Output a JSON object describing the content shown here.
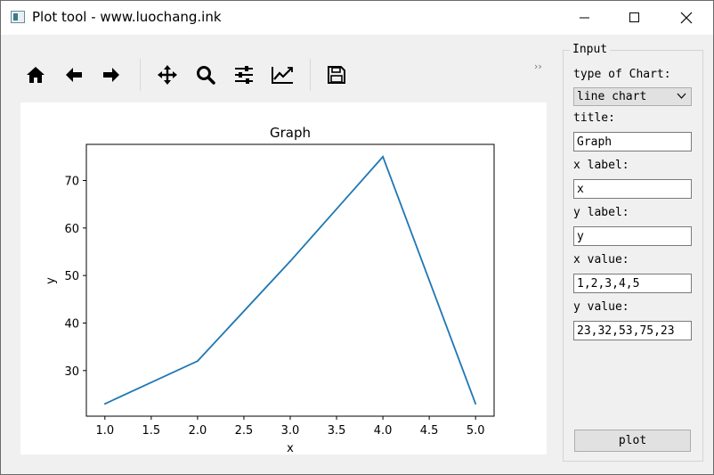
{
  "window": {
    "title": "Plot tool - www.luochang.ink",
    "controls": [
      "minimize-icon",
      "maximize-icon",
      "close-icon"
    ]
  },
  "toolbar": {
    "buttons": [
      {
        "icon": "home-icon"
      },
      {
        "icon": "back-arrow-icon"
      },
      {
        "icon": "forward-arrow-icon"
      },
      {
        "icon": "pan-icon"
      },
      {
        "icon": "zoom-icon"
      },
      {
        "icon": "configure-subplots-icon"
      },
      {
        "icon": "edit-axis-icon"
      },
      {
        "icon": "save-icon"
      }
    ],
    "overflow": "››"
  },
  "panel": {
    "group_title": "Input",
    "chart_type_label": "type of Chart:",
    "chart_type_value": "line chart",
    "title_label": "title:",
    "title_value": "Graph",
    "xlabel_label": "x label:",
    "xlabel_value": "x",
    "ylabel_label": "y label:",
    "ylabel_value": "y",
    "xvalue_label": "x value:",
    "xvalue_value": "1,2,3,4,5",
    "yvalue_label": "y value:",
    "yvalue_value": "23,32,53,75,23",
    "plot_button": "plot"
  },
  "chart_data": {
    "type": "line",
    "title": "Graph",
    "xlabel": "x",
    "ylabel": "y",
    "x": [
      1,
      2,
      3,
      4,
      5
    ],
    "series": [
      {
        "values": [
          23,
          32,
          53,
          75,
          23
        ],
        "color": "#1f77b4"
      }
    ],
    "xlim": [
      0.8,
      5.2
    ],
    "ylim": [
      20.4,
      77.6
    ],
    "xticks": [
      "1.0",
      "1.5",
      "2.0",
      "2.5",
      "3.0",
      "3.5",
      "4.0",
      "4.5",
      "5.0"
    ],
    "yticks": [
      "30",
      "40",
      "50",
      "60",
      "70"
    ],
    "grid": false
  }
}
